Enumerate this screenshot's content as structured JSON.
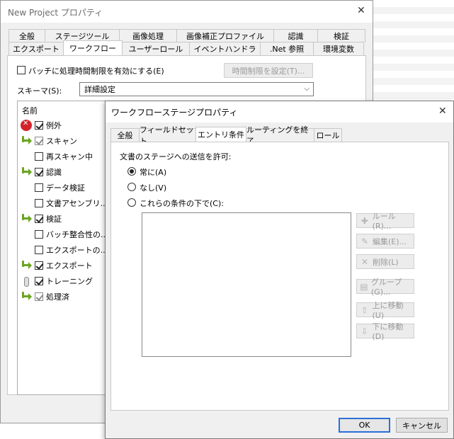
{
  "back_window": {
    "title": "New Project プロパティ",
    "tabs_row1": [
      "全般",
      "ステージツール",
      "画像処理",
      "画像補正プロファイル",
      "認識",
      "検証"
    ],
    "tabs_row2": [
      "エクスポート",
      "ワークフロー",
      "ユーザーロール",
      "イベントハンドラ",
      ".Net 参照",
      "環境変数"
    ],
    "active_tab": "ワークフロー",
    "batch_limit_label": "バッチに処理時間制限を有効にする(E)",
    "batch_limit_button": "時間制限を設定(T)...",
    "schema_label": "スキーマ(S):",
    "schema_value": "詳細設定",
    "tree_header": "名前",
    "tree_items": [
      {
        "label": "例外",
        "icon": "error-icon",
        "checked": true,
        "indent": 0
      },
      {
        "label": "スキャン",
        "icon": "arrow-icon",
        "checked": true,
        "indent": 0,
        "dim": true
      },
      {
        "label": "再スキャン中",
        "icon": "",
        "checked": false,
        "indent": 1
      },
      {
        "label": "認識",
        "icon": "arrow-icon",
        "checked": true,
        "indent": 0
      },
      {
        "label": "データ検証",
        "icon": "",
        "checked": false,
        "indent": 1
      },
      {
        "label": "文書アセンブリ...",
        "icon": "",
        "checked": false,
        "indent": 1
      },
      {
        "label": "検証",
        "icon": "arrow-icon",
        "checked": true,
        "indent": 0
      },
      {
        "label": "バッチ整合性の...",
        "icon": "",
        "checked": false,
        "indent": 1
      },
      {
        "label": "エクスポートの...",
        "icon": "",
        "checked": false,
        "indent": 1
      },
      {
        "label": "エクスポート",
        "icon": "arrow-icon",
        "checked": true,
        "indent": 0
      },
      {
        "label": "トレーニング",
        "icon": "trace-icon",
        "checked": true,
        "indent": 0
      },
      {
        "label": "処理済",
        "icon": "arrow-icon",
        "checked": true,
        "indent": 0,
        "dim": true
      }
    ]
  },
  "dialog": {
    "title": "ワークフローステージプロパティ",
    "tabs": [
      "全般",
      "フィールドセット",
      "エントリ条件",
      "ルーティングを終了",
      "ロール"
    ],
    "active_tab": "エントリ条件",
    "section_label": "文書のステージへの送信を許可:",
    "radio_always": "常に(A)",
    "radio_none": "なし(V)",
    "radio_conditions": "これらの条件の下で(C):",
    "selected_radio": "always",
    "side_buttons": [
      {
        "label": "ルール(R)...",
        "icon": "plus-icon"
      },
      {
        "label": "編集(E)...",
        "icon": "pencil-icon"
      },
      {
        "label": "削除(L)",
        "icon": "delete-icon"
      },
      {
        "label": "グループ(G)...",
        "icon": "group-icon"
      },
      {
        "label": "上に移動(U)",
        "icon": "up-arrow-icon"
      },
      {
        "label": "下に移動(D)",
        "icon": "down-arrow-icon"
      }
    ],
    "ok_label": "OK",
    "cancel_label": "キャンセル"
  }
}
